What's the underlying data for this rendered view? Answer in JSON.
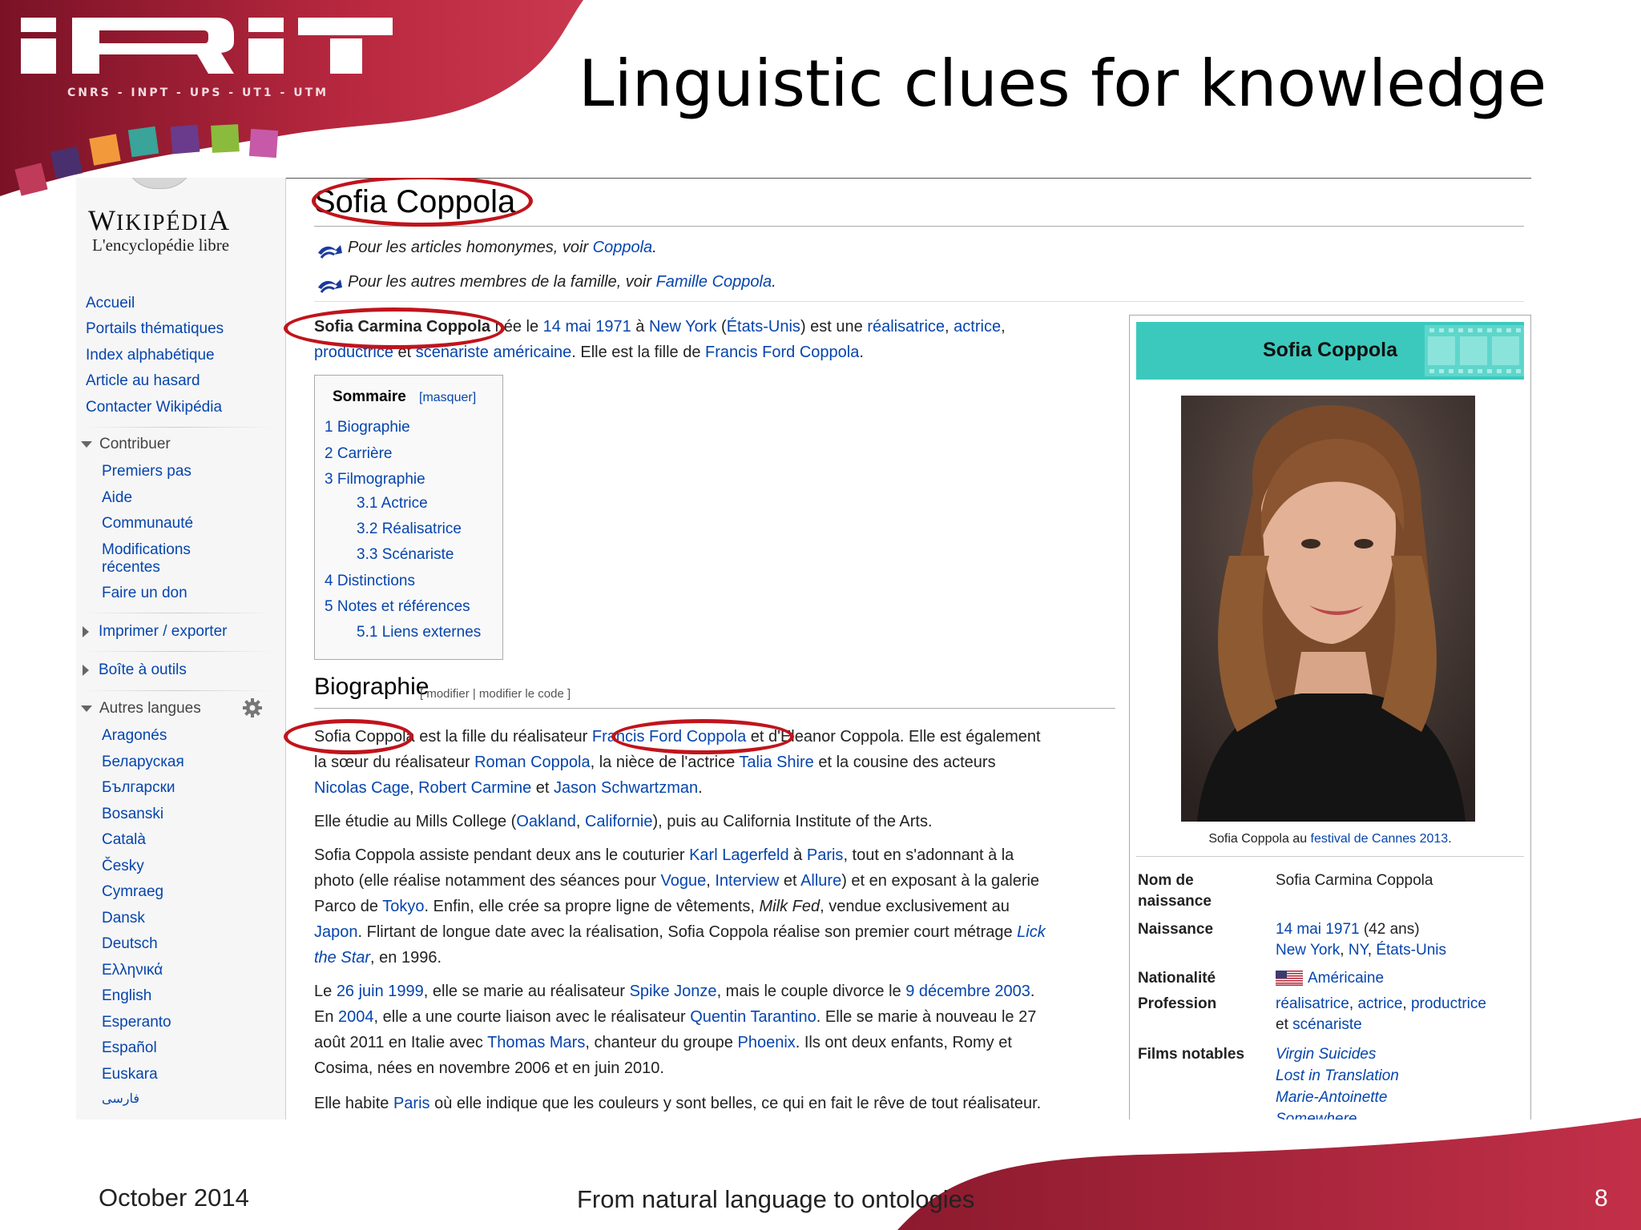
{
  "slide": {
    "logo": "IRiT",
    "logo_sub": "CNRS - INPT - UPS - UT1 - UTM",
    "title": "Linguistic clues for knowledge",
    "footer_date": "October 2014",
    "footer_center": "From natural language to ontologies",
    "page_number": "8",
    "accent_color": "#b8283f"
  },
  "wiki": {
    "logo_word": "Wikipédia",
    "logo_tagline": "L'encyclopédie libre",
    "nav": [
      "Accueil",
      "Portails thématiques",
      "Index alphabétique",
      "Article au hasard",
      "Contacter Wikipédia"
    ],
    "contribute": {
      "heading": "Contribuer",
      "items": [
        "Premiers pas",
        "Aide",
        "Communauté",
        "Modifications",
        "récentes",
        "Faire un don"
      ]
    },
    "print_export": "Imprimer / exporter",
    "tools": "Boîte à outils",
    "languages": {
      "heading": "Autres langues",
      "items": [
        "Aragonés",
        "Беларуская",
        "Български",
        "Bosanski",
        "Català",
        "Česky",
        "Cymraeg",
        "Dansk",
        "Deutsch",
        "Ελληνικά",
        "English",
        "Esperanto",
        "Español",
        "Euskara",
        "فارسی"
      ]
    },
    "article_title": "Sofia Coppola",
    "hatnotes": [
      {
        "text": "Pour les articles homonymes, voir ",
        "link": "Coppola",
        "end": "."
      },
      {
        "text": "Pour les autres membres de la famille, voir ",
        "link": "Famille Coppola",
        "end": "."
      }
    ],
    "lead": {
      "bold_name": "Sofia Carmina Coppola",
      "line1": [
        " née le ",
        "14 mai 1971",
        " à ",
        "New York",
        " (",
        "États-Unis",
        ") est une ",
        "réalisatrice",
        ", ",
        "actrice",
        ","
      ],
      "line2": [
        "productrice",
        " et ",
        "scénariste",
        " ",
        "américaine",
        ". Elle est la fille de ",
        "Francis Ford Coppola",
        "."
      ]
    },
    "toc": {
      "title": "Sommaire",
      "hide": "[masquer]",
      "items": [
        "1 Biographie",
        "2 Carrière",
        "3 Filmographie",
        "3.1 Actrice",
        "3.2 Réalisatrice",
        "3.3 Scénariste",
        "4 Distinctions",
        "5 Notes et références",
        "5.1 Liens externes"
      ]
    },
    "section_title": "Biographie",
    "section_edit": "[ modifier | modifier le code ]",
    "bio": {
      "p1l1": [
        "Sofia Coppola",
        " est la fille du réalisateur ",
        "Francis Ford Coppola",
        " et d'Eleanor Coppola. Elle est également"
      ],
      "p1l2": [
        "la sœur du réalisateur ",
        "Roman Coppola",
        ", la nièce de l'actrice ",
        "Talia Shire",
        " et la cousine des acteurs"
      ],
      "p1l3": [
        "Nicolas Cage",
        ", ",
        "Robert Carmine",
        " et ",
        "Jason Schwartzman",
        "."
      ],
      "p2": [
        "Elle étudie au Mills College (",
        "Oakland",
        ", ",
        "Californie",
        "), puis au California Institute of the Arts."
      ],
      "p3l1": [
        "Sofia Coppola assiste pendant deux ans le couturier ",
        "Karl Lagerfeld",
        " à ",
        "Paris",
        ", tout en s'adonnant à la"
      ],
      "p3l2": [
        "photo (elle réalise notamment des séances pour ",
        "Vogue",
        ", ",
        "Interview",
        " et ",
        "Allure",
        ") et en exposant à la galerie"
      ],
      "p3l3": [
        "Parco de ",
        "Tokyo",
        ". Enfin, elle crée sa propre ligne de vêtements, ",
        "Milk Fed",
        ", vendue exclusivement au"
      ],
      "p3l4": [
        "Japon",
        ". Flirtant de longue date avec la réalisation, Sofia Coppola réalise son premier court métrage ",
        "Lick"
      ],
      "p3l5": [
        "the Star",
        ", en 1996."
      ],
      "p4l1": [
        "Le ",
        "26 juin 1999",
        ", elle se marie au réalisateur ",
        "Spike Jonze",
        ", mais le couple divorce le ",
        "9 décembre 2003",
        "."
      ],
      "p4l2": [
        "En ",
        "2004",
        ", elle a une courte liaison avec le réalisateur ",
        "Quentin Tarantino",
        ". Elle se marie à nouveau le 27"
      ],
      "p4l3": [
        "août 2011 en Italie avec ",
        "Thomas Mars",
        ", chanteur du groupe ",
        "Phoenix",
        ". Ils ont deux enfants, Romy et"
      ],
      "p4l4": [
        "Cosima, nées en novembre 2006 et en juin 2010."
      ],
      "p5": [
        "Elle habite ",
        "Paris",
        " où elle indique que les couleurs y sont belles, ce qui en fait le rêve de tout réalisateur."
      ]
    },
    "infobox": {
      "title": "Sofia Coppola",
      "caption": [
        "Sofia Coppola au ",
        "festival de Cannes 2013",
        "."
      ],
      "header_color": "#3cc9bd",
      "rows": {
        "birth_name_label": [
          "Nom de",
          "naissance"
        ],
        "birth_name": "Sofia Carmina Coppola",
        "birth_label": "Naissance",
        "birth_date": "14 mai 1971",
        "birth_age": " (42 ans)",
        "birth_place": [
          "New York",
          ", ",
          "NY",
          ", ",
          "États-Unis"
        ],
        "nationality_label": "Nationalité",
        "nationality": "Américaine",
        "profession_label": "Profession",
        "profession_l1": [
          "réalisatrice",
          ", ",
          "actrice",
          ", ",
          "productrice"
        ],
        "profession_l2": [
          "et ",
          "scénariste"
        ],
        "films_label": "Films notables",
        "films": [
          "Virgin Suicides",
          "Lost in Translation",
          "Marie-Antoinette",
          "Somewhere"
        ]
      }
    }
  }
}
